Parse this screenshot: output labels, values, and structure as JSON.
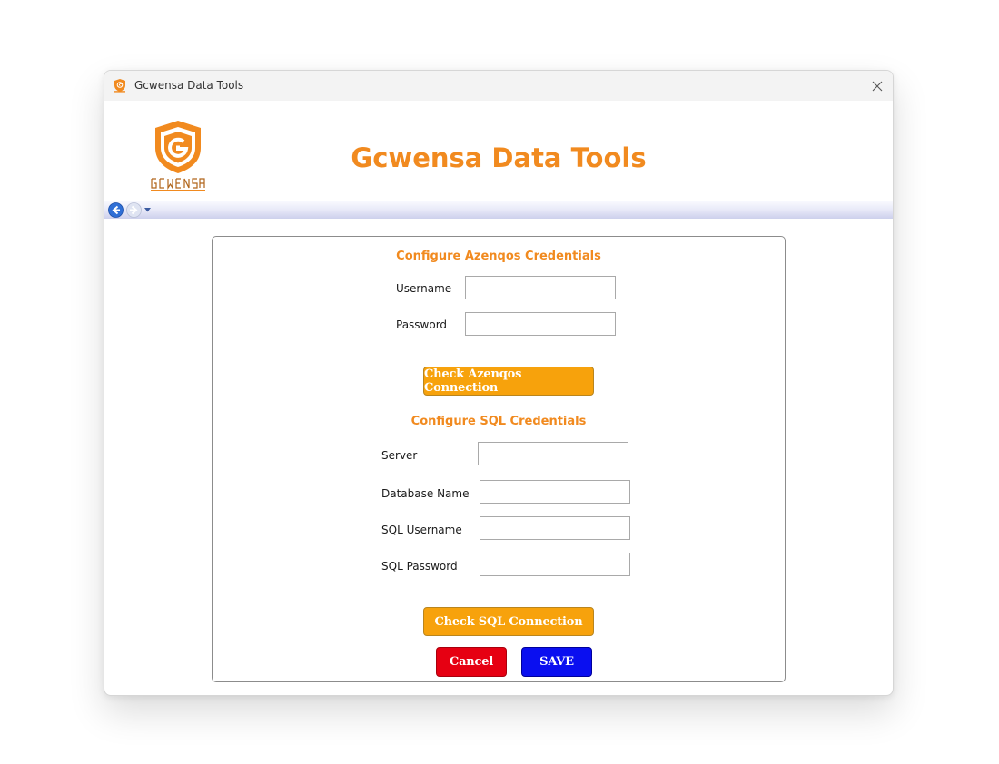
{
  "window": {
    "title": "Gcwensa Data Tools",
    "icons": {
      "app": "app-logo-icon",
      "close": "close-icon"
    }
  },
  "header": {
    "logo_icon": "gcwensa-shield-logo",
    "app_title": "Gcwensa Data Tools"
  },
  "navbar": {
    "icons": [
      "back-arrow-icon",
      "forward-arrow-icon",
      "dropdown-arrow-icon"
    ]
  },
  "azenqos": {
    "section_title": "Configure Azenqos Credentials",
    "username_label": "Username",
    "username_value": "",
    "password_label": "Password",
    "password_value": "",
    "check_button": "Check Azenqos Connection"
  },
  "sql": {
    "section_title": "Configure SQL Credentials",
    "server_label": "Server",
    "server_value": "",
    "database_label": "Database Name",
    "database_value": "",
    "username_label": "SQL Username",
    "username_value": "",
    "password_label": "SQL Password",
    "password_value": "",
    "check_button": "Check SQL Connection"
  },
  "actions": {
    "cancel_label": "Cancel",
    "save_label": "SAVE"
  },
  "colors": {
    "accent_orange": "#f18a1f",
    "button_orange": "#f7a20c",
    "cancel_red": "#e60012",
    "save_blue": "#0a0ff0"
  }
}
